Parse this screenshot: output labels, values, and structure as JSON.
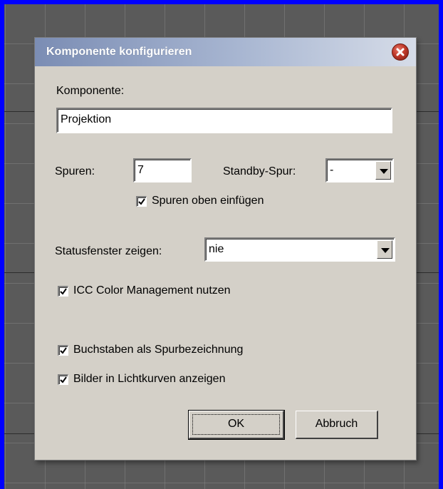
{
  "dialog": {
    "title": "Komponente konfigurieren",
    "component_label": "Komponente:",
    "component_value": "Projektion",
    "tracks_label": "Spuren:",
    "tracks_value": "7",
    "standby_label": "Standby-Spur:",
    "standby_value": "-",
    "insert_top_label": "Spuren oben einfügen",
    "insert_top_checked": true,
    "status_label": "Statusfenster zeigen:",
    "status_value": "nie",
    "icc_label": "ICC Color Management nutzen",
    "icc_checked": true,
    "letters_label": "Buchstaben als Spurbezeichnung",
    "letters_checked": true,
    "images_label": "Bilder in Lichtkurven anzeigen",
    "images_checked": true,
    "ok_label": "OK",
    "cancel_label": "Abbruch"
  },
  "colors": {
    "desktop": "#0000ff",
    "dialog_face": "#d4d0c8",
    "close_button": "#c0392b"
  }
}
